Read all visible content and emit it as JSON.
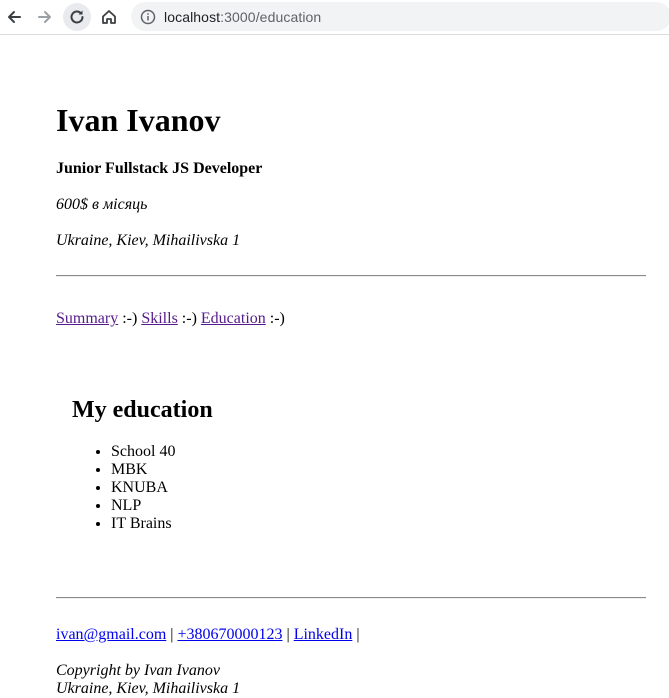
{
  "browser": {
    "url_host": "localhost",
    "url_path": ":3000/education"
  },
  "header": {
    "name": "Ivan Ivanov",
    "role": "Junior Fullstack JS Developer",
    "salary": "600$ в місяць",
    "address": "Ukraine, Kiev, Mihailivska 1"
  },
  "nav": {
    "summary": "Summary",
    "skills": "Skills",
    "education": "Education",
    "separator": " :-) "
  },
  "education": {
    "title": "My education",
    "items": [
      "School 40",
      "MBK",
      "KNUBA",
      "NLP",
      "IT Brains"
    ]
  },
  "footer": {
    "email": "ivan@gmail.com",
    "phone": "+380670000123",
    "linkedin": "LinkedIn",
    "separator": " | ",
    "copyright": "Copyright by Ivan Ivanov",
    "address": "Ukraine, Kiev, Mihailivska 1"
  },
  "colors": {
    "visited_link": "#551a8b",
    "link": "#0000ee",
    "omnibox_bg": "#f1f3f4"
  },
  "icons": [
    "back-arrow-icon",
    "forward-arrow-icon",
    "reload-icon",
    "home-icon",
    "info-icon"
  ]
}
